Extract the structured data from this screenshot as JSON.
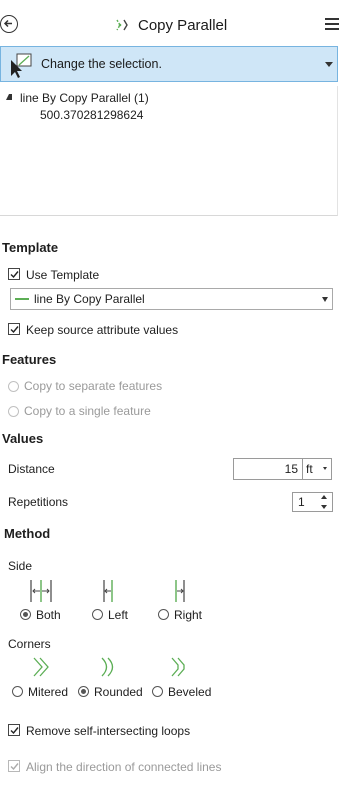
{
  "header": {
    "title": "Copy Parallel"
  },
  "selection": {
    "prompt": "Change the selection."
  },
  "tree": {
    "layer": "line By Copy Parallel (1)",
    "value": "500.370281298624"
  },
  "template": {
    "heading": "Template",
    "use_template_label": "Use Template",
    "use_template_checked": true,
    "selected": "line By Copy Parallel",
    "keep_attr_label": "Keep source attribute values",
    "keep_attr_checked": true
  },
  "features": {
    "heading": "Features",
    "options": [
      "Copy to separate features",
      "Copy to a single feature"
    ],
    "enabled": false
  },
  "values": {
    "heading": "Values",
    "distance_label": "Distance",
    "distance_value": "15",
    "distance_unit": "ft",
    "repetitions_label": "Repetitions",
    "repetitions_value": "1"
  },
  "method": {
    "heading": "Method",
    "side_label": "Side",
    "side_options": [
      "Both",
      "Left",
      "Right"
    ],
    "side_selected": "Both",
    "corners_label": "Corners",
    "corner_options": [
      "Mitered",
      "Rounded",
      "Beveled"
    ],
    "corner_selected": "Rounded"
  },
  "options": {
    "remove_loops_label": "Remove self-intersecting loops",
    "remove_loops_checked": true,
    "align_label": "Align the direction of connected lines",
    "align_checked": true,
    "align_enabled": false
  },
  "colors": {
    "accent_bg": "#cfe6f7",
    "accent_border": "#77b4e0",
    "line_green": "#5cae55"
  }
}
